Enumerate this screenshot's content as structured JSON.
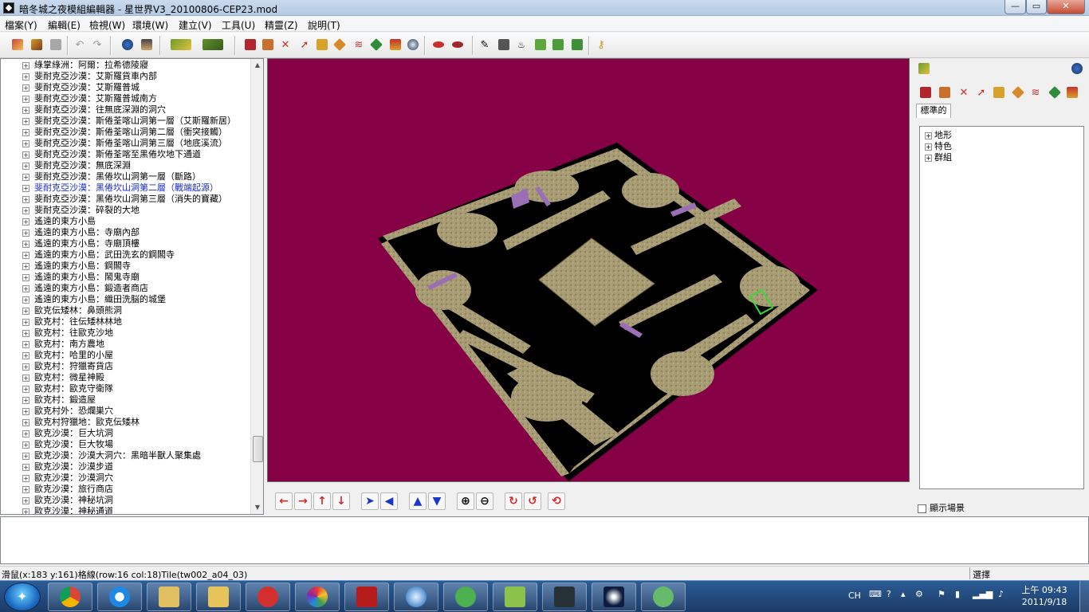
{
  "window": {
    "title": "暗冬城之夜模組編輯器 - 星世界V3_20100806-CEP23.mod",
    "min_label": "—",
    "max_label": "▭",
    "close_label": "✕"
  },
  "menu": [
    "檔案(Y)",
    "編輯(E)",
    "檢視(W)",
    "環境(W)",
    "建立(V)",
    "工具(U)",
    "精靈(Z)",
    "說明(T)"
  ],
  "tree": {
    "items": [
      "綠掌綠洲：阿爾：拉希德陵寢",
      "斐耐克亞沙漠：艾斯羅貨車內部",
      "斐耐克亞沙漠：艾斯羅普城",
      "斐耐克亞沙漠：艾斯羅普城南方",
      "斐耐克亞沙漠：往無底深淵的洞穴",
      "斐耐克亞沙漠：斯倦荃喀山洞第一層（艾斯羅新居）",
      "斐耐克亞沙漠：斯倦荃喀山洞第二層（衝突接觸）",
      "斐耐克亞沙漠：斯倦荃喀山洞第三層（地底溪流）",
      "斐耐克亞沙漠：斯倦荃喀至黑倦坎地下通道",
      "斐耐克亞沙漠：無底深淵",
      "斐耐克亞沙漠：黑倦坎山洞第一層（斷路）",
      "斐耐克亞沙漠：黑倦坎山洞第二層（戰端起源）",
      "斐耐克亞沙漠：黑倦坎山洞第三層（消失的寶藏）",
      "斐耐克亞沙漠：碎裂的大地",
      "遙遠的東方小島",
      "遙遠的東方小島：寺廟內部",
      "遙遠的東方小島：寺廟頂樓",
      "遙遠的東方小島：武田洗玄的鋼閣寺",
      "遙遠的東方小島：鋼閣寺",
      "遙遠的東方小島：鬧鬼寺廟",
      "遙遠的東方小島：鍛造者商店",
      "遙遠的東方小島：織田洗脳的城堡",
      "歐克伝矮林：鼻頭熊洞",
      "歐克村：往伝矮林林地",
      "歐克村：往歐克沙地",
      "歐克村：南方農地",
      "歐克村：哈里的小屋",
      "歐克村：狩獵寄貨店",
      "歐克村：微星神殿",
      "歐克村：歐克守衛隊",
      "歐克村：鍛造屋",
      "歐克村外：恐爛巣穴",
      "歐克村狩獵地：歐克伝矮林",
      "歐克沙漠：巨大坑洞",
      "歐克沙漠：巨大牧場",
      "歐克沙漠：沙漠大洞穴：黑暗半獸人聚集處",
      "歐克沙漠：沙漠步道",
      "歐克沙漠：沙漠洞穴",
      "歐克沙漠：旅行商店",
      "歐克沙漠：神秘坑洞",
      "歐克沙漠：神秘通道"
    ],
    "selected_index": 11,
    "expander": "+"
  },
  "right_panel": {
    "tab_label": "標準的",
    "tree_items": [
      "地形",
      "特色",
      "群組"
    ],
    "checkbox_label": "顯示場景",
    "checkbox_checked": false
  },
  "status": {
    "left": "滑鼠(x:183 y:161)格線(row:16 col:18)Tile(tw002_a04_03)",
    "right": "選擇"
  },
  "taskbar": {
    "lang": "CH",
    "clock_time": "上午 09:43",
    "clock_date": "2011/9/18"
  },
  "colors": {
    "viewport_bg": "#850045",
    "map_floor": "#a89c74",
    "map_wall": "#000000"
  }
}
